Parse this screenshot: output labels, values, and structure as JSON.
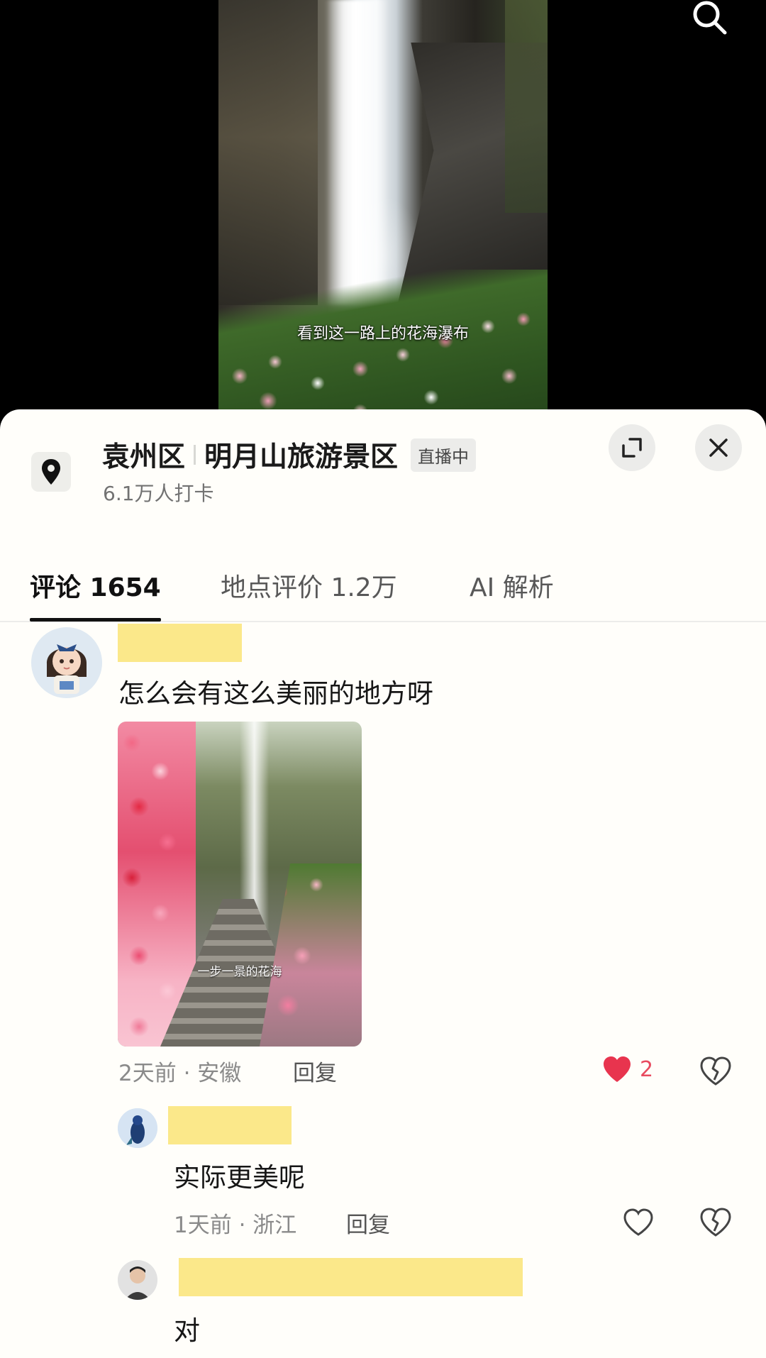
{
  "video": {
    "subtitle": "看到这一路上的花海瀑布"
  },
  "location": {
    "district": "袁州区",
    "name": "明月山旅游景区",
    "live_badge": "直播中",
    "checkins": "6.1万人打卡"
  },
  "tabs": [
    {
      "label": "评论 1654",
      "active": true
    },
    {
      "label": "地点评价 1.2万",
      "active": false
    },
    {
      "label": "AI 解析",
      "active": false
    }
  ],
  "comments": [
    {
      "text": "怎么会有这么美丽的地方呀",
      "image_caption": "一步一景的花海",
      "time_location": "2天前 · 安徽",
      "reply_label": "回复",
      "likes": "2",
      "liked": true
    },
    {
      "text": "实际更美呢",
      "time_location": "1天前 · 浙江",
      "reply_label": "回复",
      "likes": "",
      "liked": false
    },
    {
      "text": "对"
    }
  ],
  "colors": {
    "sheet_bg": "#fffefa",
    "like_red": "#e84a5f",
    "redaction_yellow": "#fbe88a"
  }
}
